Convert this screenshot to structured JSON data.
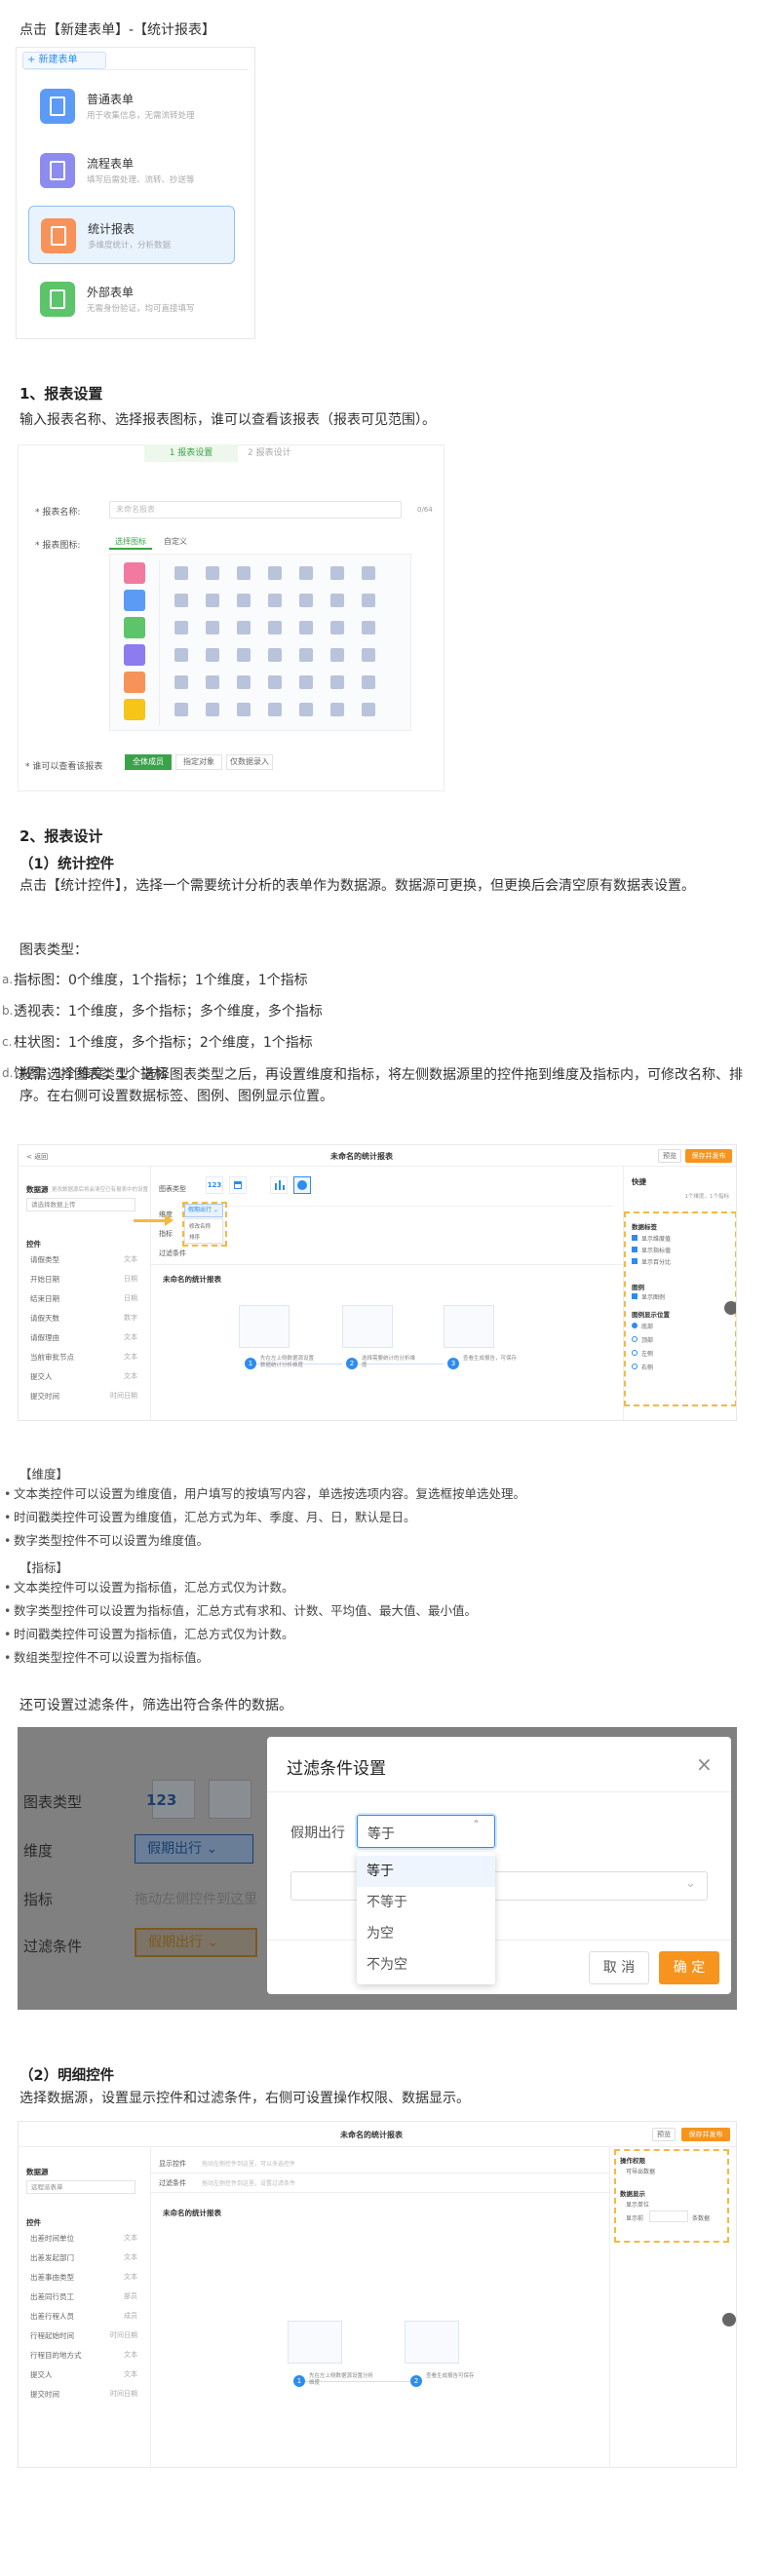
{
  "intro_text": "点击【新建表单】-【统计报表】",
  "new_form_menu": {
    "button": "新建表单",
    "items": [
      {
        "title": "普通表单",
        "subtitle": "用于收集信息，无需流转处理",
        "icon": "document-icon",
        "color": "#5b9bf5",
        "selected": false
      },
      {
        "title": "流程表单",
        "subtitle": "填写后需处理、流转、抄送等",
        "icon": "flow-document-icon",
        "color": "#8c8cf0",
        "selected": false
      },
      {
        "title": "统计报表",
        "subtitle": "多维度统计，分析数据",
        "icon": "report-icon",
        "color": "#f7935a",
        "selected": true
      },
      {
        "title": "外部表单",
        "subtitle": "无需身份验证，均可直接填写",
        "icon": "external-form-icon",
        "color": "#5cc46a",
        "selected": false
      }
    ]
  },
  "section1": {
    "heading": "1、报表设置",
    "desc": "输入报表名称、选择报表图标，谁可以查看该报表（报表可见范围）。",
    "shot": {
      "step1": "1 报表设置",
      "step2": "2 报表设计",
      "name_label": "* 报表名称:",
      "name_placeholder": "未命名报表",
      "name_count": "0/64",
      "icon_label": "* 报表图标:",
      "tab_select": "选择图标",
      "tab_custom": "自定义",
      "swatch_colors": [
        "#f27aa0",
        "#5b9bf5",
        "#5cc46a",
        "#8c7cf0",
        "#f7935a",
        "#f5c518"
      ],
      "visible_label": "* 谁可以查看该报表",
      "visible_options": [
        "全体成员",
        "指定对象",
        "仅数据录入"
      ]
    }
  },
  "section2": {
    "heading": "2、报表设计",
    "sub1": "（1）统计控件",
    "p1": "点击【统计控件】，选择一个需要统计分析的表单作为数据源。数据源可更换，但更换后会清空原有数据表设置。",
    "chart_types_label": "图表类型：",
    "chart_types": [
      {
        "marker": "a.",
        "text": "指标图：0个维度，1个指标；1个维度，1个指标"
      },
      {
        "marker": "b.",
        "text": "透视表：1个维度，多个指标；多个维度，多个指标"
      },
      {
        "marker": "c.",
        "text": "柱状图：1个维度，多个指标；2个维度，1个指标"
      },
      {
        "marker": "d.",
        "text": "饼图：1个维度，1个指标"
      }
    ],
    "p2": "按需选择图表类型。选择图表类型之后，再设置维度和指标，将左侧数据源里的控件拖到维度及指标内，可修改名称、排序。在右侧可设置数据标签、图例、图例显示位置。",
    "designer": {
      "back": "< 返回",
      "title": "未命名的统计报表",
      "btn_preview": "预览",
      "btn_save": "保存并发布",
      "ds_label": "数据源",
      "ds_hint": "更改数据源后将会清空已有报表中的设置",
      "ds_value": "请选择数据上传",
      "ctrl_label": "控件",
      "ctrl_items": [
        [
          "请假类型",
          "文本"
        ],
        [
          "开始日期",
          "日期"
        ],
        [
          "结束日期",
          "日期"
        ],
        [
          "请假天数",
          "数字"
        ],
        [
          "请假理由",
          "文本"
        ],
        [
          "当前审批节点",
          "文本"
        ],
        [
          "提交人",
          "文本"
        ],
        [
          "提交时间",
          "时间日期"
        ]
      ],
      "row_chart": "图表类型",
      "row_dim": "维度",
      "row_ind": "指标",
      "row_filter": "过滤条件",
      "dim_tag": "假期出行 ⌄",
      "dim_menu": [
        "修改名称",
        "排序"
      ],
      "canvas_title": "未命名的统计报表",
      "steps": [
        "先在左上侧数据源设置数据统计分析维度",
        "选择需要统计的分析维度",
        "查看生成报告，可保存"
      ],
      "panel_title": "快捷",
      "panel_hint": "1个维度，1个指标",
      "data_label": "数据标签",
      "checks": [
        "显示维度值",
        "显示指标值",
        "显示百分比"
      ],
      "legend": "图例",
      "legend_check": "显示图例",
      "legend_pos": "图例显示位置",
      "positions": [
        "底部",
        "顶部",
        "左侧",
        "右侧"
      ]
    },
    "dim_note_title": "【维度】",
    "dim_notes": [
      "文本类控件可以设置为维度值，用户填写的按填写内容，单选按选项内容。复选框按单选处理。",
      "时间戳类控件可设置为维度值，汇总方式为年、季度、月、日，默认是日。",
      "数字类型控件不可以设置为维度值。"
    ],
    "ind_note_title": "【指标】",
    "ind_notes": [
      "文本类控件可以设置为指标值，汇总方式仅为计数。",
      "数字类型控件可以设置为指标值，汇总方式有求和、计数、平均值、最大值、最小值。",
      "时间戳类控件可设置为指标值，汇总方式仅为计数。",
      "数组类型控件不可以设置为指标值。"
    ],
    "filter_intro": "还可设置过滤条件，筛选出符合条件的数据。",
    "filter_shot": {
      "bg_rows": [
        "图表类型",
        "维度",
        "指标",
        "过滤条件"
      ],
      "bg_dim_tag": "假期出行 ⌄",
      "bg_ind_hint": "拖动左侧控件到这里",
      "bg_filter_tag": "假期出行 ⌄",
      "dialog_title": "过滤条件设置",
      "field": "假期出行",
      "select_value": "等于",
      "options": [
        "等于",
        "不等于",
        "为空",
        "不为空"
      ],
      "cancel": "取 消",
      "ok": "确 定"
    },
    "sub2": "（2）明细控件",
    "p3": "选择数据源，设置显示控件和过滤条件，右侧可设置操作权限、数据显示。",
    "detail": {
      "title": "未命名的统计报表",
      "btn_preview": "预览",
      "btn_save": "保存并发布",
      "ds_label": "数据源",
      "ds_value": "远程派表单",
      "ctrl_label": "控件",
      "ctrl_items": [
        [
          "出差时间单位",
          "文本"
        ],
        [
          "出差发起部门",
          "文本"
        ],
        [
          "出差事由类型",
          "文本"
        ],
        [
          "出差同行员工",
          "部员"
        ],
        [
          "出差行程人员",
          "成员"
        ],
        [
          "行程起始时间",
          "时间日期"
        ],
        [
          "行程目的地方式",
          "文本"
        ],
        [
          "提交人",
          "文本"
        ],
        [
          "提交时间",
          "时间日期"
        ]
      ],
      "row_show": "显示控件",
      "row_filter": "过滤条件",
      "row_show_hint": "拖动左侧控件到这里，可以多选控件",
      "row_filter_hint": "拖动左侧控件到这里，设置过滤条件",
      "canvas_title": "未命名的统计报表",
      "steps": [
        "先在左上侧数据源设置分析维度",
        "查看生成报告可保存"
      ],
      "perm_title": "操作权限",
      "perm_value": "可导出数据",
      "display_title": "数据显示",
      "display_sub": "显示单位",
      "display_row": "显示前",
      "display_unit": "条数据"
    }
  }
}
